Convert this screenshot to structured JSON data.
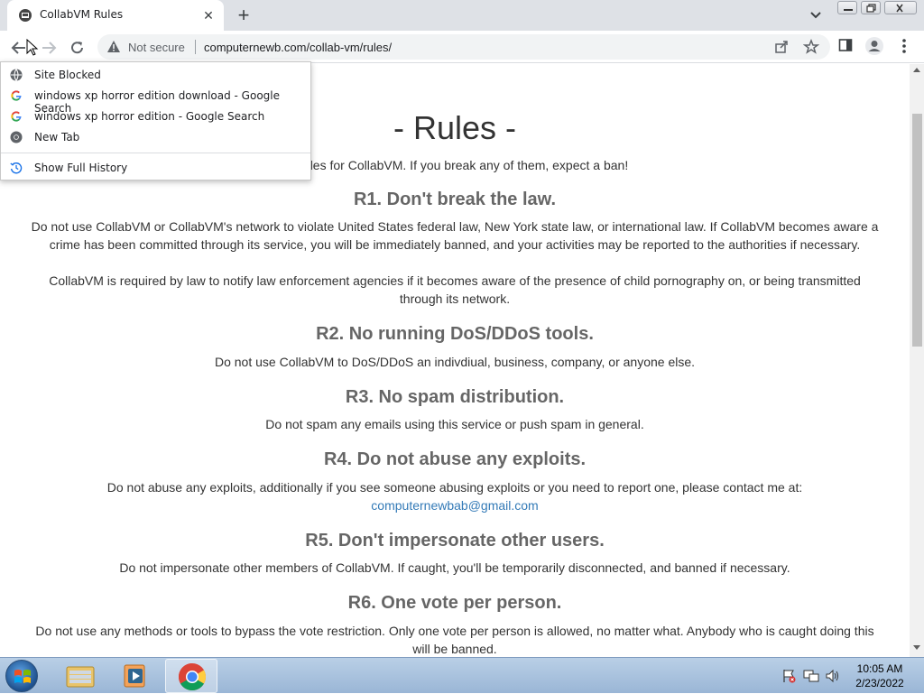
{
  "browser": {
    "tab": {
      "title": "CollabVM Rules"
    },
    "omnibox": {
      "security_label": "Not secure",
      "url": "computernewb.com/collab-vm/rules/"
    }
  },
  "history_menu": {
    "items": [
      {
        "label": "Site Blocked",
        "icon": "globe-icon"
      },
      {
        "label": "windows xp horror edition download - Google Search",
        "icon": "google-icon"
      },
      {
        "label": "windows xp horror edition - Google Search",
        "icon": "google-icon"
      },
      {
        "label": "New Tab",
        "icon": "chrome-icon"
      }
    ],
    "show_full_history": "Show Full History"
  },
  "page": {
    "title": "- Rules -",
    "intro": "he rules for CollabVM. If you break any of them, expect a ban!",
    "rules": [
      {
        "heading": "R1. Don't break the law.",
        "paragraphs": [
          "Do not use CollabVM or CollabVM's network to violate United States federal law, New York state law, or international law. If CollabVM becomes aware a crime has been committed through its service, you will be immediately banned, and your activities may be reported to the authorities if necessary.",
          "CollabVM is required by law to notify law enforcement agencies if it becomes aware of the presence of child pornography on, or being transmitted through its network."
        ]
      },
      {
        "heading": "R2. No running DoS/DDoS tools.",
        "paragraphs": [
          "Do not use CollabVM to DoS/DDoS an indivdiual, business, company, or anyone else."
        ]
      },
      {
        "heading": "R3. No spam distribution.",
        "paragraphs": [
          "Do not spam any emails using this service or push spam in general."
        ]
      },
      {
        "heading": "R4. Do not abuse any exploits.",
        "paragraphs": [
          "Do not abuse any exploits, additionally if you see someone abusing exploits or you need to report one, please contact me at:"
        ],
        "email": "computernewbab@gmail.com"
      },
      {
        "heading": "R5. Don't impersonate other users.",
        "paragraphs": [
          "Do not impersonate other members of CollabVM. If caught, you'll be temporarily disconnected, and banned if necessary."
        ]
      },
      {
        "heading": "R6. One vote per person.",
        "paragraphs": [
          "Do not use any methods or tools to bypass the vote restriction. Only one vote per person is allowed, no matter what. Anybody who is caught doing this will be banned."
        ]
      }
    ]
  },
  "taskbar": {
    "apps": [
      "explorer-icon",
      "media-player-icon",
      "chrome-icon"
    ],
    "clock": {
      "time": "10:05 AM",
      "date": "2/23/2022"
    }
  }
}
